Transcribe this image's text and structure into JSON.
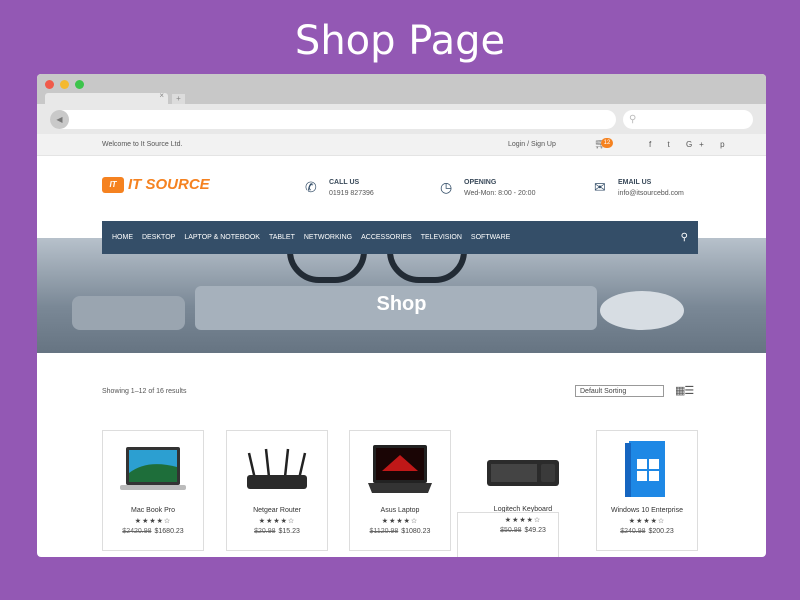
{
  "banner": {
    "title": "Shop Page"
  },
  "topbar": {
    "welcome": "Welcome to It Source Ltd.",
    "login": "Login / Sign Up",
    "cart_count": "12",
    "social": [
      "f",
      "t",
      "G+",
      "p"
    ]
  },
  "header": {
    "logo_mark": "IT",
    "logo_text": "IT SOURCE",
    "call_label": "CALL US",
    "call_value": "01919 827396",
    "opening_label": "OPENING",
    "opening_value": "Wed-Mon: 8:00 - 20:00",
    "email_label": "EMAIL US",
    "email_value": "info@itsourcebd.com"
  },
  "nav": {
    "items": [
      "HOME",
      "DESKTOP",
      "LAPTOP & NOTEBOOK",
      "TABLET",
      "NETWORKING",
      "ACCESSORIES",
      "TELEVISION",
      "SOFTWARE"
    ]
  },
  "hero": {
    "title": "Shop"
  },
  "shop": {
    "result_count": "Showing 1–12 of 16 results",
    "sort": "Default Sorting"
  },
  "products": [
    {
      "name": "Mac Book Pro",
      "old_price": "$2420.98",
      "price": "$1680.23",
      "rating": "★★★★☆"
    },
    {
      "name": "Netgear Router",
      "old_price": "$20.98",
      "price": "$15.23",
      "rating": "★★★★☆"
    },
    {
      "name": "Asus Laptop",
      "old_price": "$1120.98",
      "price": "$1080.23",
      "rating": "★★★★☆"
    },
    {
      "name": "Logitech Keyboard",
      "old_price": "$50.98",
      "price": "$49.23",
      "rating": "★★★★☆"
    },
    {
      "name": "Windows 10 Enterprise",
      "old_price": "$240.98",
      "price": "$200.23",
      "rating": "★★★★☆"
    }
  ],
  "colors": {
    "accent": "#f58220",
    "nav": "#344e68",
    "background": "#9358b4"
  }
}
